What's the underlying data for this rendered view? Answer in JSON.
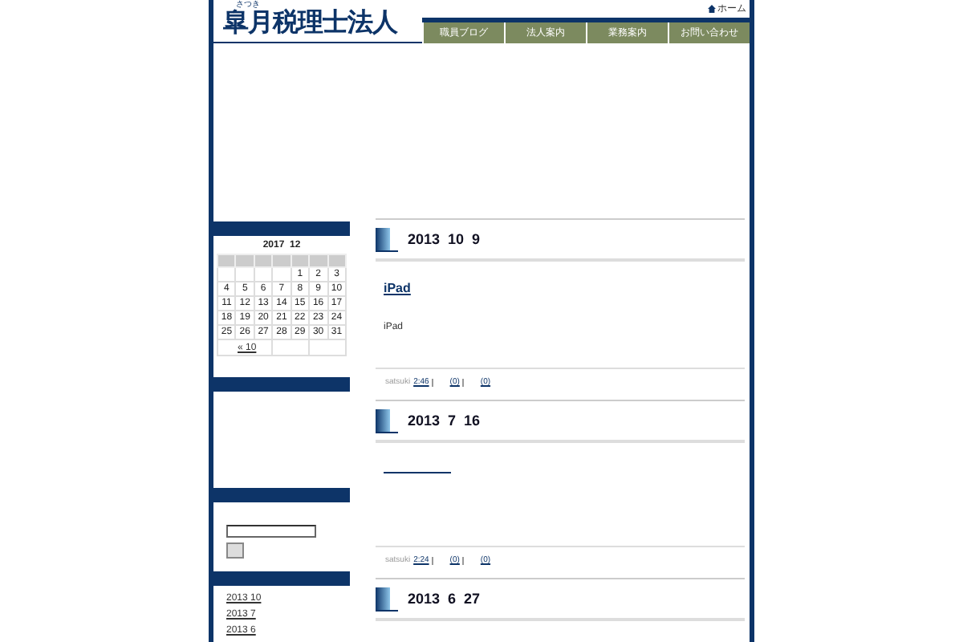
{
  "header": {
    "logo": "皐月税理士法人",
    "logo_reading": "さつき",
    "home_link": "ホーム"
  },
  "nav": [
    {
      "label": "職員ブログ"
    },
    {
      "label": "法人案内"
    },
    {
      "label": "業務案内"
    },
    {
      "label": "お問い合わせ"
    }
  ],
  "sidebar": {
    "calendar": {
      "title": "2017  12",
      "weeks": [
        [
          "1",
          "2",
          "3"
        ],
        [
          "4",
          "5",
          "6",
          "7",
          "8",
          "9",
          "10"
        ],
        [
          "11",
          "12",
          "13",
          "14",
          "15",
          "16",
          "17"
        ],
        [
          "18",
          "19",
          "20",
          "21",
          "22",
          "23",
          "24"
        ],
        [
          "25",
          "26",
          "27",
          "28",
          "29",
          "30",
          "31"
        ]
      ],
      "prev_link": "« 10"
    },
    "archives": [
      "2013 10",
      "2013 7",
      "2013 6"
    ]
  },
  "entries": [
    {
      "date": "2013  10  9",
      "title": "iPad",
      "body": "iPad",
      "author": "satsuki",
      "time": "2:46",
      "counts": [
        "(0)",
        "(0)"
      ]
    },
    {
      "date": "2013  7  16",
      "author": "satsuki",
      "time": "2:24",
      "counts": [
        "(0)",
        "(0)"
      ]
    },
    {
      "date": "2013  6  27"
    }
  ]
}
